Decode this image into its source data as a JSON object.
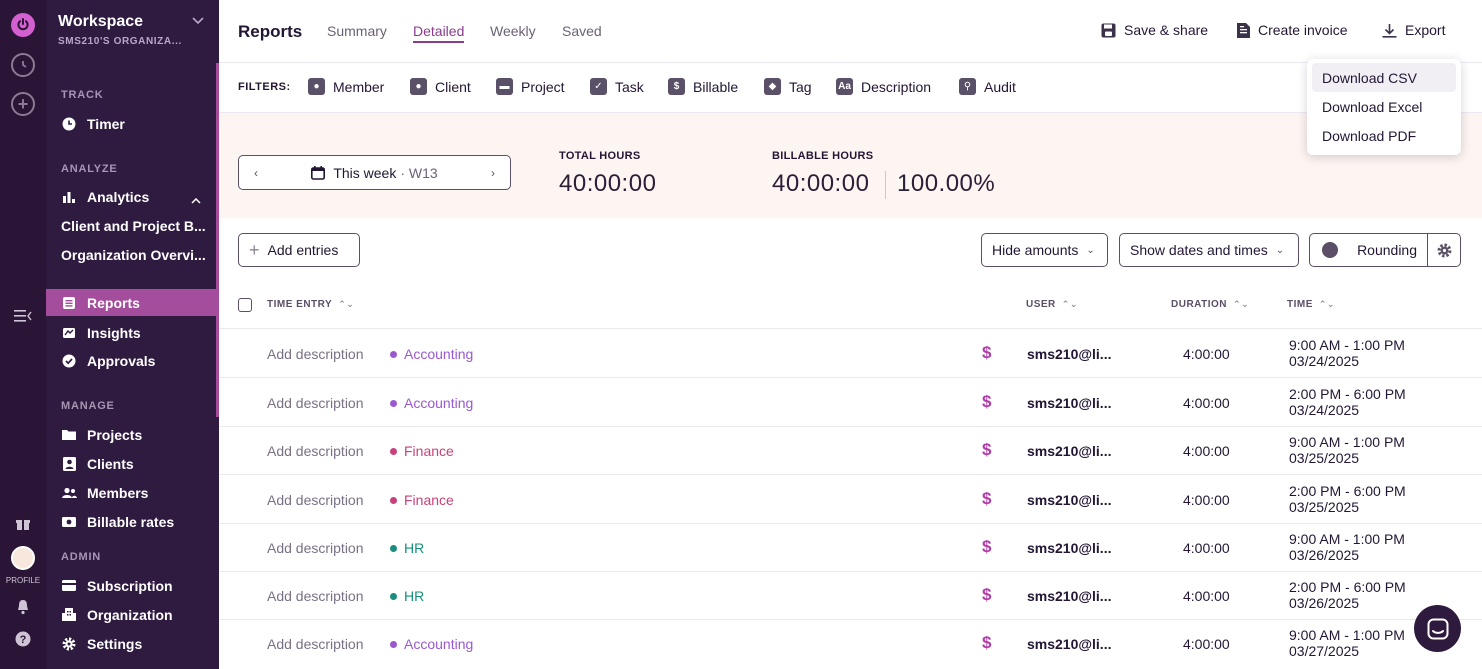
{
  "workspace": {
    "title": "Workspace",
    "subtitle": "SMS210'S ORGANIZA..."
  },
  "rail": {
    "profile_label": "PROFILE"
  },
  "sidebar": {
    "track_label": "TRACK",
    "timer": "Timer",
    "analyze_label": "ANALYZE",
    "analytics": "Analytics",
    "analytics_sub": [
      "Client and Project B...",
      "Organization Overvi..."
    ],
    "reports": "Reports",
    "insights": "Insights",
    "approvals": "Approvals",
    "manage_label": "MANAGE",
    "projects": "Projects",
    "clients": "Clients",
    "members": "Members",
    "billable_rates": "Billable rates",
    "admin_label": "ADMIN",
    "subscription": "Subscription",
    "organization": "Organization",
    "settings": "Settings"
  },
  "header": {
    "title": "Reports",
    "tabs": [
      "Summary",
      "Detailed",
      "Weekly",
      "Saved"
    ],
    "active_tab": "Detailed",
    "save_share": "Save & share",
    "create_invoice": "Create invoice",
    "export": "Export"
  },
  "filters": {
    "label": "FILTERS:",
    "items": [
      "Member",
      "Client",
      "Project",
      "Task",
      "Billable",
      "Tag",
      "Description",
      "Audit"
    ]
  },
  "summary": {
    "week_label": "This week",
    "week_num": "· W13",
    "total_hours_label": "TOTAL HOURS",
    "total_hours": "40:00:00",
    "billable_hours_label": "BILLABLE HOURS",
    "billable_hours": "40:00:00",
    "billable_pct": "100.00%"
  },
  "toolbar": {
    "add_entries": "Add entries",
    "hide_amounts": "Hide amounts",
    "show_dates": "Show dates and times",
    "rounding": "Rounding"
  },
  "table": {
    "headers": {
      "entry": "TIME ENTRY",
      "user": "USER",
      "duration": "DURATION",
      "time": "TIME"
    },
    "rows": [
      {
        "desc": "Add description",
        "project": "Accounting",
        "color": "#9b59d0",
        "billable": "$",
        "user": "sms210@li...",
        "duration": "4:00:00",
        "time": "9:00 AM - 1:00 PM",
        "date": "03/24/2025"
      },
      {
        "desc": "Add description",
        "project": "Accounting",
        "color": "#9b59d0",
        "billable": "$",
        "user": "sms210@li...",
        "duration": "4:00:00",
        "time": "2:00 PM - 6:00 PM",
        "date": "03/24/2025"
      },
      {
        "desc": "Add description",
        "project": "Finance",
        "color": "#c8417a",
        "billable": "$",
        "user": "sms210@li...",
        "duration": "4:00:00",
        "time": "9:00 AM - 1:00 PM",
        "date": "03/25/2025"
      },
      {
        "desc": "Add description",
        "project": "Finance",
        "color": "#c8417a",
        "billable": "$",
        "user": "sms210@li...",
        "duration": "4:00:00",
        "time": "2:00 PM - 6:00 PM",
        "date": "03/25/2025"
      },
      {
        "desc": "Add description",
        "project": "HR",
        "color": "#168f7c",
        "billable": "$",
        "user": "sms210@li...",
        "duration": "4:00:00",
        "time": "9:00 AM - 1:00 PM",
        "date": "03/26/2025"
      },
      {
        "desc": "Add description",
        "project": "HR",
        "color": "#168f7c",
        "billable": "$",
        "user": "sms210@li...",
        "duration": "4:00:00",
        "time": "2:00 PM - 6:00 PM",
        "date": "03/26/2025"
      },
      {
        "desc": "Add description",
        "project": "Accounting",
        "color": "#9b59d0",
        "billable": "$",
        "user": "sms210@li...",
        "duration": "4:00:00",
        "time": "9:00 AM - 1:00 PM",
        "date": "03/27/2025"
      }
    ]
  },
  "export_menu": {
    "items": [
      "Download CSV",
      "Download Excel",
      "Download PDF"
    ],
    "hovered": "Download CSV"
  },
  "colors": {
    "accent": "#a44d9c",
    "sidebar_bg": "#2f1a40",
    "rail_bg": "#2a1536",
    "summary_bg": "#fdf5f1",
    "billable": "#b13bab"
  }
}
